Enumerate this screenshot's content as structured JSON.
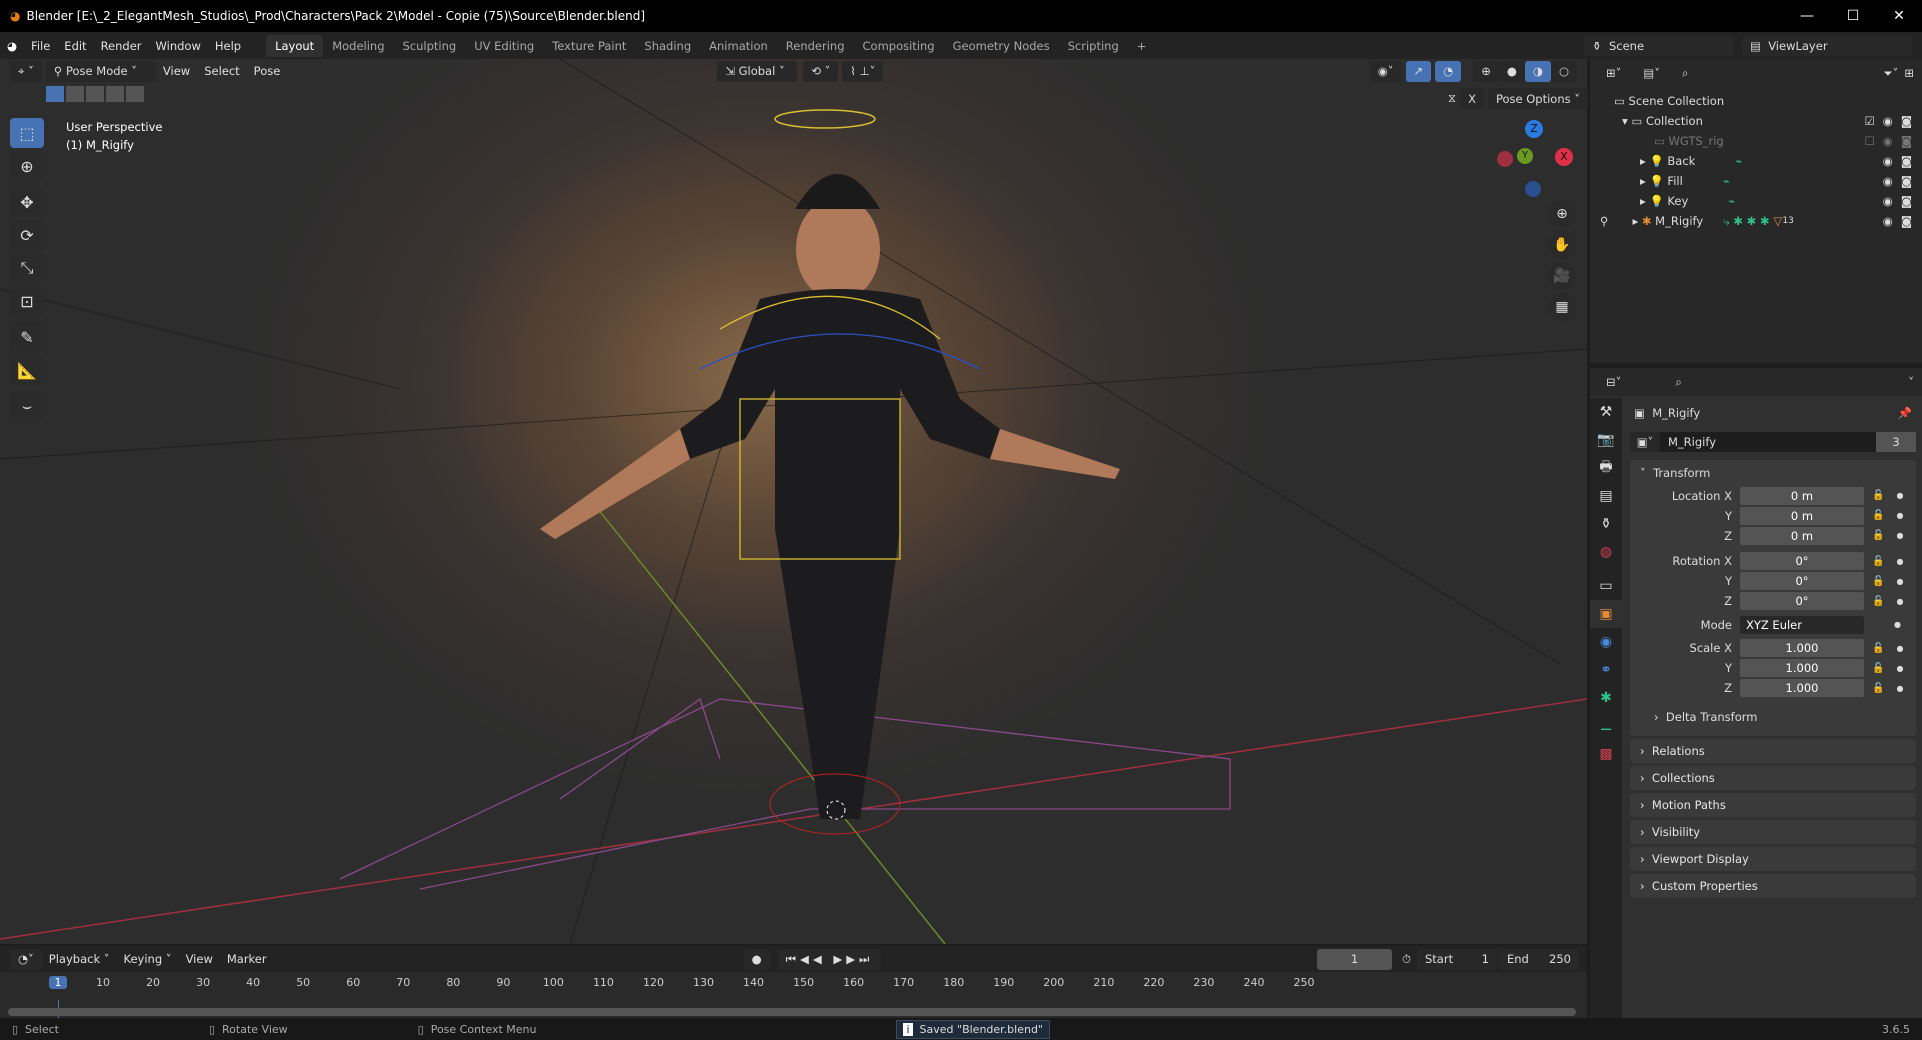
{
  "title_bar": {
    "title": "Blender [E:\\_2_ElegantMesh_Studios\\_Prod\\Characters\\Pack 2\\Model - Copie (75)\\Source\\Blender.blend]",
    "minimize": "—",
    "maximize": "☐",
    "close": "✕"
  },
  "menu": [
    "File",
    "Edit",
    "Render",
    "Window",
    "Help"
  ],
  "workspaces": [
    {
      "label": "Layout",
      "active": true
    },
    {
      "label": "Modeling"
    },
    {
      "label": "Sculpting"
    },
    {
      "label": "UV Editing"
    },
    {
      "label": "Texture Paint"
    },
    {
      "label": "Shading"
    },
    {
      "label": "Animation"
    },
    {
      "label": "Rendering"
    },
    {
      "label": "Compositing"
    },
    {
      "label": "Geometry Nodes"
    },
    {
      "label": "Scripting"
    }
  ],
  "add_workspace": "+",
  "scene": "Scene",
  "view_layer": "ViewLayer",
  "viewport": {
    "mode": "Pose Mode",
    "menus": [
      "View",
      "Select",
      "Pose"
    ],
    "orientation": "Global",
    "pose_options": "Pose Options",
    "x_mirror": "X",
    "overlay_title": "User Perspective",
    "overlay_object": "(1) M_Rigify",
    "gizmo": {
      "x": "X",
      "y": "Y",
      "z": "Z"
    },
    "accent": "#4772b3"
  },
  "outliner": {
    "root": "Scene Collection",
    "items": [
      {
        "label": "Collection",
        "level": 1
      },
      {
        "label": "WGTS_rig",
        "level": 2,
        "disabled": true
      },
      {
        "label": "Back",
        "level": 2
      },
      {
        "label": "Fill",
        "level": 2
      },
      {
        "label": "Key",
        "level": 2
      },
      {
        "label": "M_Rigify",
        "level": 2,
        "badge": "13"
      }
    ]
  },
  "properties": {
    "object_name": "M_Rigify",
    "data_name": "M_Rigify",
    "users": "3",
    "transform_label": "Transform",
    "location": {
      "label": "Location X",
      "x": "0 m",
      "y": "0 m",
      "z": "0 m"
    },
    "rotation": {
      "label": "Rotation X",
      "x": "0°",
      "y": "0°",
      "z": "0°"
    },
    "mode_label": "Mode",
    "mode": "XYZ Euler",
    "scale": {
      "label": "Scale X",
      "x": "1.000",
      "y": "1.000",
      "z": "1.000"
    },
    "y_label": "Y",
    "z_label": "Z",
    "delta": "Delta Transform",
    "panels": [
      "Relations",
      "Collections",
      "Motion Paths",
      "Visibility",
      "Viewport Display",
      "Custom Properties"
    ]
  },
  "timeline": {
    "menus": [
      "Playback",
      "Keying",
      "View",
      "Marker"
    ],
    "current_frame": "1",
    "start_label": "Start",
    "start": "1",
    "end_label": "End",
    "end": "250",
    "ticks": [
      "1",
      "10",
      "20",
      "30",
      "40",
      "50",
      "60",
      "70",
      "80",
      "90",
      "100",
      "110",
      "120",
      "130",
      "140",
      "150",
      "160",
      "170",
      "180",
      "190",
      "200",
      "210",
      "220",
      "230",
      "240",
      "250"
    ]
  },
  "status": {
    "select": "Select",
    "rotate": "Rotate View",
    "context": "Pose Context Menu",
    "message": "Saved \"Blender.blend\"",
    "version": "3.6.5"
  }
}
